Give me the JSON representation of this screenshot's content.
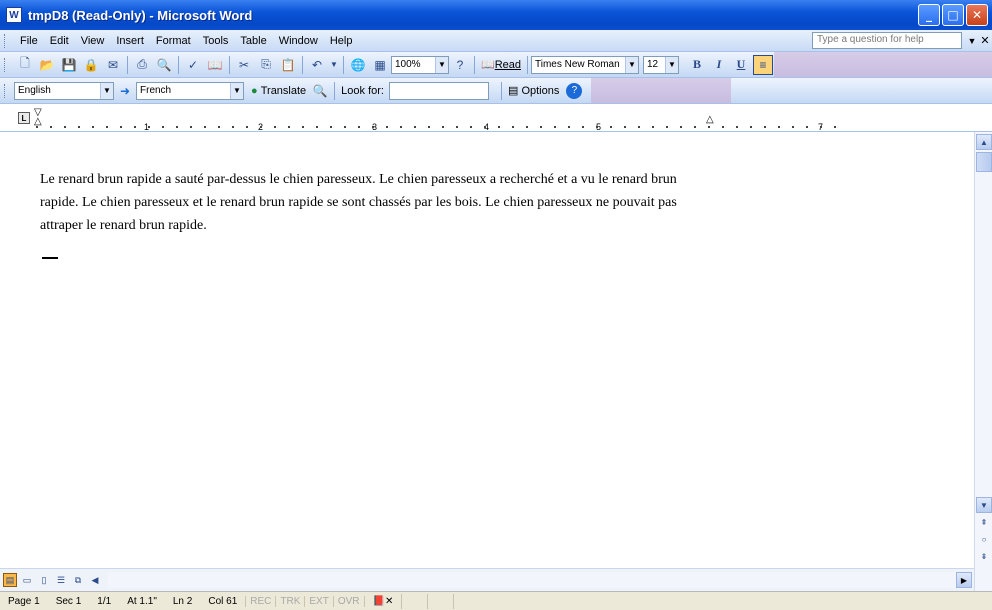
{
  "window": {
    "title": "tmpD8 (Read-Only) - Microsoft Word",
    "app_icon": "W"
  },
  "menu": {
    "items": [
      "File",
      "Edit",
      "View",
      "Insert",
      "Format",
      "Tools",
      "Table",
      "Window",
      "Help"
    ],
    "help_placeholder": "Type a question for help"
  },
  "standard_toolbar": {
    "zoom": "100%",
    "read_label": "Read",
    "font": "Times New Roman",
    "size": "12",
    "bold": "B",
    "italic": "I",
    "underline": "U"
  },
  "translate_toolbar": {
    "from_lang": "English",
    "to_lang": "French",
    "translate_label": "Translate",
    "look_for_label": "Look for:",
    "look_for_value": "",
    "options_label": "Options"
  },
  "ruler": {
    "numbers": [
      "1",
      "2",
      "3",
      "4",
      "5",
      "7"
    ]
  },
  "document": {
    "text": "Le renard brun rapide a sauté par-dessus le chien paresseux. Le chien paresseux a recherché et a vu le renard brun rapide. Le chien paresseux et le renard brun rapide se sont chassés par les bois. Le chien paresseux ne pouvait pas attraper le renard brun rapide."
  },
  "status": {
    "page": "Page 1",
    "sec": "Sec 1",
    "pages": "1/1",
    "at": "At 1.1\"",
    "ln": "Ln 2",
    "col": "Col 61",
    "rec": "REC",
    "trk": "TRK",
    "ext": "EXT",
    "ovr": "OVR"
  }
}
